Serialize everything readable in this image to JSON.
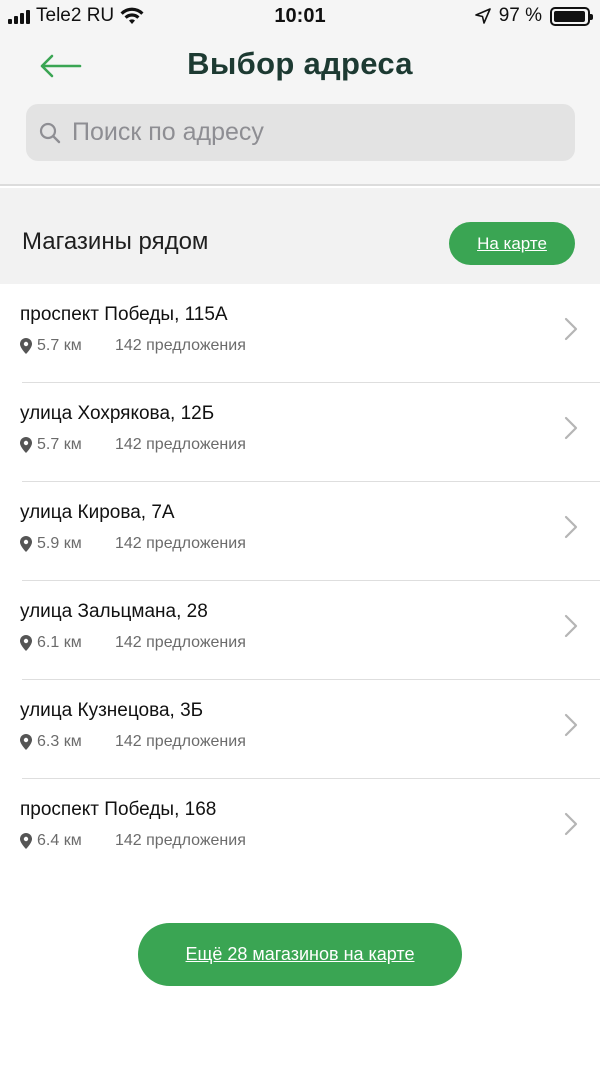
{
  "status_bar": {
    "carrier": "Tele2 RU",
    "time": "10:01",
    "battery": "97 %"
  },
  "header": {
    "title": "Выбор адреса",
    "back_icon": "arrow-left-icon"
  },
  "search": {
    "placeholder": "Поиск по адресу",
    "icon": "search-icon"
  },
  "section": {
    "title": "Магазины рядом",
    "map_button": "На карте"
  },
  "stores": [
    {
      "address": "проспект Победы, 115А",
      "distance": "5.7 км",
      "offers": "142 предложения"
    },
    {
      "address": "улица Хохрякова, 12Б",
      "distance": "5.7 км",
      "offers": "142 предложения"
    },
    {
      "address": "улица Кирова, 7А",
      "distance": "5.9 км",
      "offers": "142 предложения"
    },
    {
      "address": "улица Зальцмана, 28",
      "distance": "6.1 км",
      "offers": "142 предложения"
    },
    {
      "address": "улица Кузнецова, 3Б",
      "distance": "6.3 км",
      "offers": "142 предложения"
    },
    {
      "address": "проспект Победы, 168",
      "distance": "6.4 км",
      "offers": "142 предложения"
    }
  ],
  "more_button": "Ещё 28 магазинов на карте",
  "colors": {
    "accent": "#3aa553",
    "title": "#1d3a32"
  }
}
